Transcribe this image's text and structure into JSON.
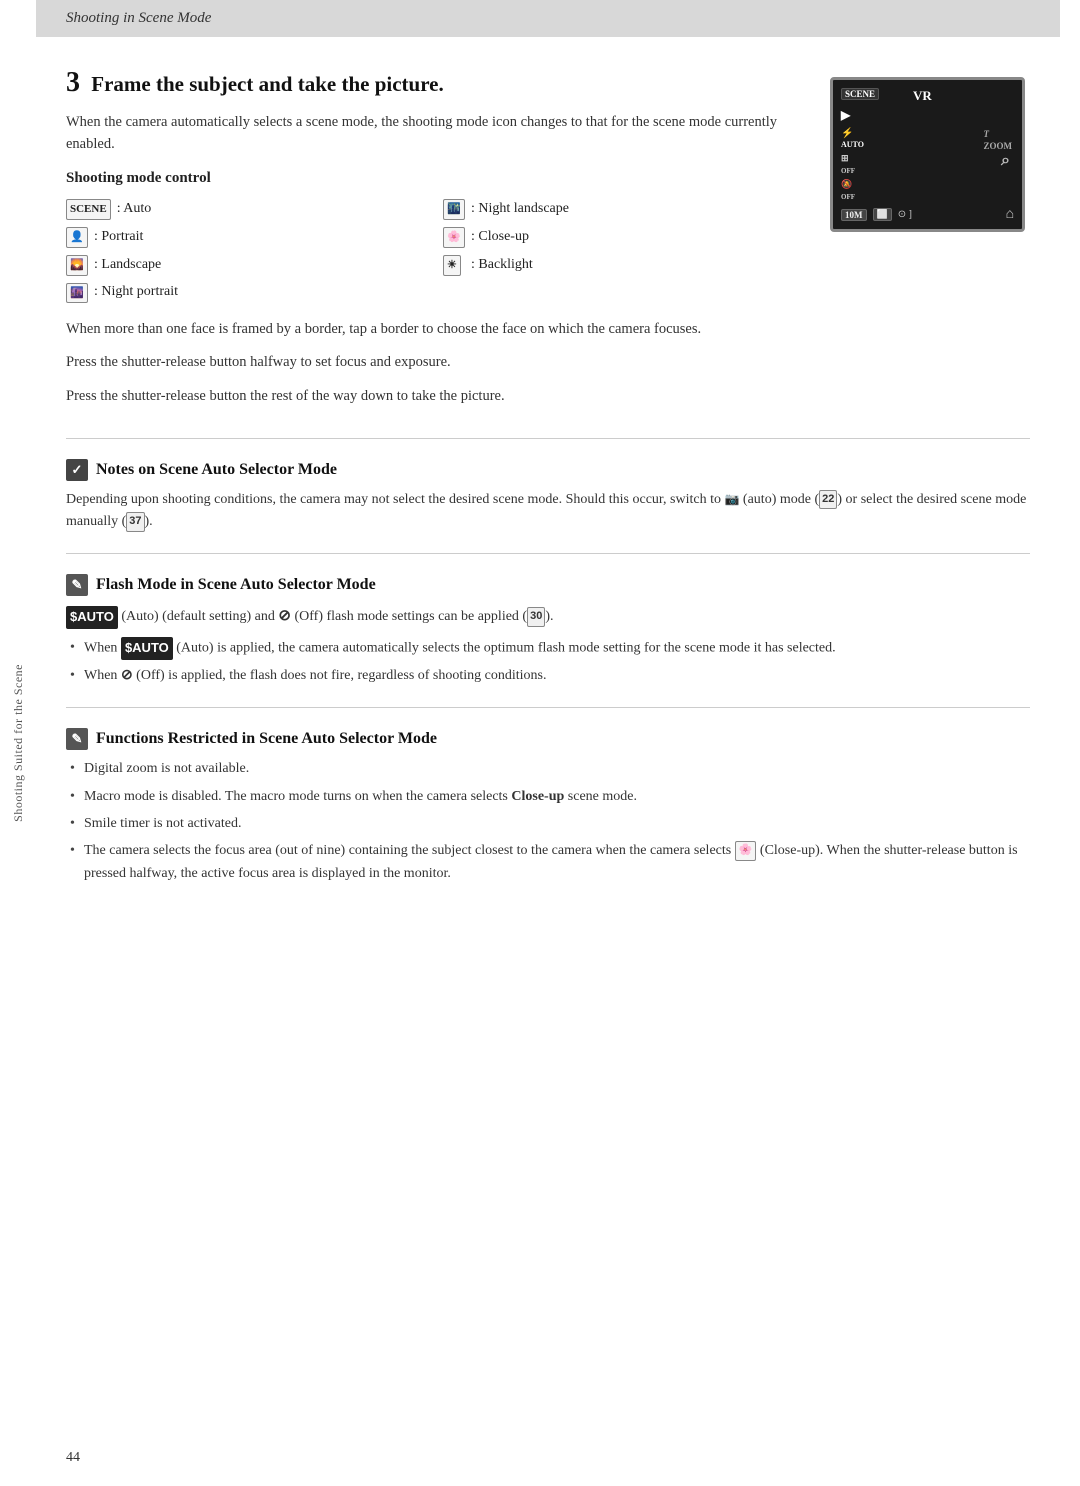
{
  "header": {
    "title": "Shooting in Scene Mode"
  },
  "sidebar": {
    "label": "Shooting Suited for the Scene"
  },
  "step3": {
    "number": "3",
    "heading": "Frame the subject and take the picture.",
    "description": "When the camera automatically selects a scene mode, the shooting mode icon changes to that for the scene mode currently enabled.",
    "shooting_mode_control": {
      "label": "Shooting mode control",
      "modes": [
        {
          "icon": "SCENE",
          "label": "Auto",
          "col": 1
        },
        {
          "icon": "🌃",
          "label": "Night landscape",
          "col": 2
        },
        {
          "icon": "👤",
          "label": "Portrait",
          "col": 1
        },
        {
          "icon": "🌸",
          "label": "Close-up",
          "col": 2
        },
        {
          "icon": "🌄",
          "label": "Landscape",
          "col": 1
        },
        {
          "icon": "☀",
          "label": "Backlight",
          "col": 2
        },
        {
          "icon": "🌆",
          "label": "Night portrait",
          "col": 1
        }
      ]
    },
    "body1": "When more than one face is framed by a border, tap a border to choose the face on which the camera focuses.",
    "body2": "Press the shutter-release button halfway to set focus and exposure.",
    "body3": "Press the shutter-release button the rest of the way down to take the picture."
  },
  "notes": {
    "scene_auto": {
      "title": "Notes on Scene Auto Selector Mode",
      "body": "Depending upon shooting conditions, the camera may not select the desired scene mode. Should this occur, switch to",
      "body_mid": "(auto) mode (",
      "ref1": "22",
      "body_mid2": ") or select the desired scene mode manually (",
      "ref2": "37",
      "body_end": ")."
    },
    "flash_mode": {
      "title": "Flash Mode in Scene Auto Selector Mode",
      "body1_pre": "(Auto) (default setting) and",
      "body1_off": "(Off) flash mode settings can be applied (",
      "ref1": "30",
      "body1_end": ").",
      "bullet1_pre": "When",
      "bullet1_auto": "FAUTO",
      "bullet1_text": "(Auto) is applied, the camera automatically selects the optimum flash mode setting for the scene mode it has selected.",
      "bullet2_pre": "When",
      "bullet2_icon": "⊘",
      "bullet2_text": "(Off) is applied, the flash does not fire, regardless of shooting conditions."
    },
    "functions": {
      "title": "Functions Restricted in Scene Auto Selector Mode",
      "bullets": [
        "Digital zoom is not available.",
        "Macro mode is disabled. The macro mode turns on when the camera selects Close-up scene mode.",
        "Smile timer is not activated.",
        "The camera selects the focus area (out of nine) containing the subject closest to the camera when the camera selects (Close-up). When the shutter-release button is pressed halfway, the active focus area is displayed in the monitor."
      ]
    }
  },
  "page_number": "44"
}
